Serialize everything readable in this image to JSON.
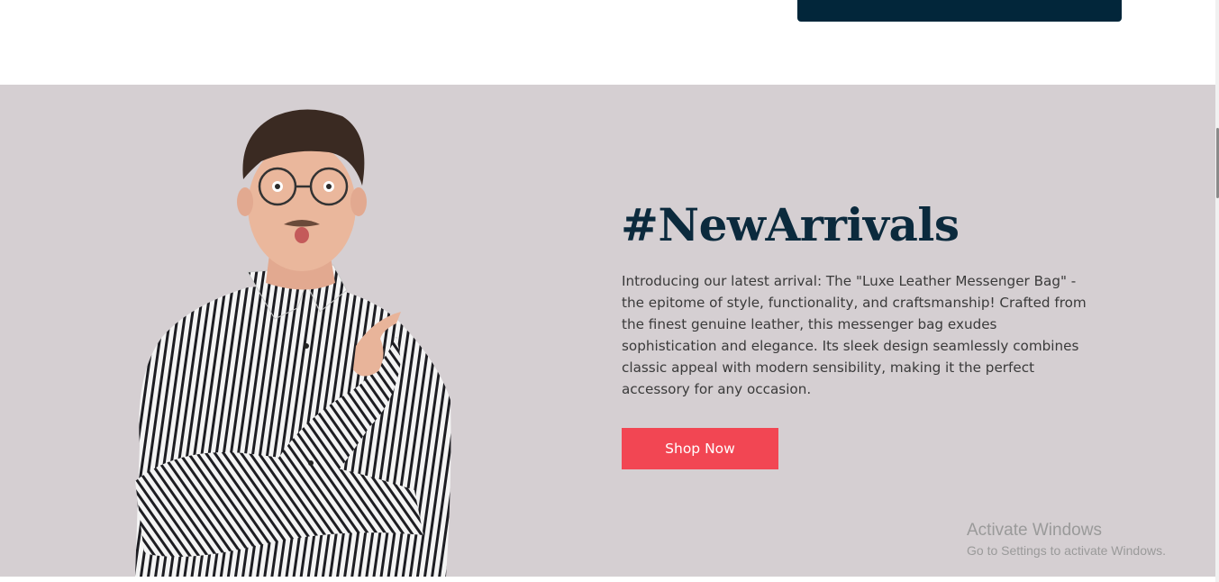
{
  "hero": {
    "heading": "#NewArrivals",
    "description": "Introducing our latest arrival: The \"Luxe Leather Messenger Bag\" - the epitome of style, functionality, and craftsmanship! Crafted from the finest genuine leather, this messenger bag exudes sophistication and elegance. Its sleek design seamlessly combines classic appeal with modern sensibility, making it the perfect accessory for any occasion.",
    "button_label": "Shop Now"
  },
  "watermark": {
    "title": "Activate Windows",
    "subtitle": "Go to Settings to activate Windows."
  },
  "colors": {
    "hero_background": "#d5cfd2",
    "heading": "#0b2a3d",
    "button": "#f24653",
    "top_bar": "#02263a"
  }
}
